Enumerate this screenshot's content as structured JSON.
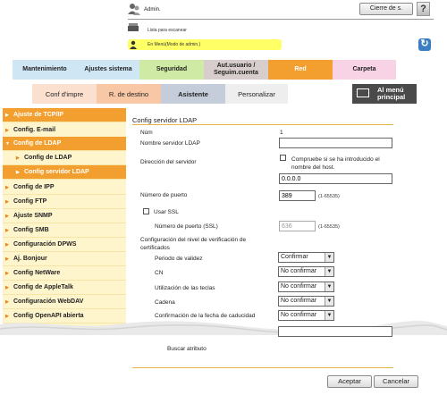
{
  "header": {
    "user": "Admin.",
    "logout_label": "Cierre de s.",
    "help_label": "?",
    "scan_list": "Lista para escanear",
    "mode": "En Menú(Modo de admin.)",
    "refresh_icon": "refresh-icon"
  },
  "tabs": [
    {
      "label": "Mantenimiento",
      "color": "#cfe6f5"
    },
    {
      "label": "Ajustes sistema",
      "color": "#cfe6f5"
    },
    {
      "label": "Seguridad",
      "color": "#cfeaa5"
    },
    {
      "label": "Aut.usuario / Seguim.cuenta",
      "color": "#d8cdcd"
    },
    {
      "label": "Red",
      "color": "#f39f30"
    },
    {
      "label": "Carpeta",
      "color": "#f8d3e6"
    }
  ],
  "subtabs": [
    {
      "label": "Conf d'impre",
      "color": "#fbe0d0"
    },
    {
      "label": "R. de destino",
      "color": "#f8c7a6"
    },
    {
      "label": "Asistente",
      "color": "#c5cddb"
    },
    {
      "label": "Personalizar",
      "color": "#eeeeee"
    },
    {
      "label": "Al menú principal",
      "color": "#4a4a4a"
    }
  ],
  "sidebar": {
    "items": [
      {
        "label": "Ajuste de TCP/IP"
      },
      {
        "label": "Config. E-mail"
      },
      {
        "label": "Config de LDAP"
      },
      {
        "label": "Config de LDAP"
      },
      {
        "label": "Config servidor LDAP"
      },
      {
        "label": "Config de IPP"
      },
      {
        "label": "Config FTP"
      },
      {
        "label": "Ajuste SNMP"
      },
      {
        "label": "Config SMB"
      },
      {
        "label": "Configuración DPWS"
      },
      {
        "label": "Aj. Bonjour"
      },
      {
        "label": "Config NetWare"
      },
      {
        "label": "Config de AppleTalk"
      },
      {
        "label": "Configuración WebDAV"
      },
      {
        "label": "Config OpenAPI abierta"
      }
    ]
  },
  "form": {
    "title": "Config servidor LDAP",
    "num_label": "Núm",
    "num_value": "1",
    "server_name_label": "Nombre servidor LDAP",
    "server_name_value": "",
    "server_address_label": "Dirección del servidor",
    "check_host_label": "Compruebe si se ha introducido el nombre del host.",
    "server_address_value": "0.0.0.0",
    "port_label": "Número de puerto",
    "port_value": "389",
    "port_range": "(1-65535)",
    "ssl_label": "Usar SSL",
    "ssl_port_label": "Número de puerto (SSL)",
    "ssl_port_value": "636",
    "ssl_port_range": "(1-65535)",
    "cert_level_label": "Configuración del nivel de verificación de certificados",
    "validity_label": "Periodo de validez",
    "validity_value": "Confirmar",
    "cn_label": "CN",
    "cn_value": "No confirmar",
    "key_usage_label": "Utilización de las teclas",
    "key_usage_value": "No confirmar",
    "chain_label": "Cadena",
    "chain_value": "No confirmar",
    "expiry_label": "Confirmación de la fecha de caducidad",
    "expiry_value": "No confirmar",
    "search_attr_label": "Buscar atributo",
    "search_attr_value": ""
  },
  "footer": {
    "accept_label": "Aceptar",
    "cancel_label": "Cancelar"
  }
}
